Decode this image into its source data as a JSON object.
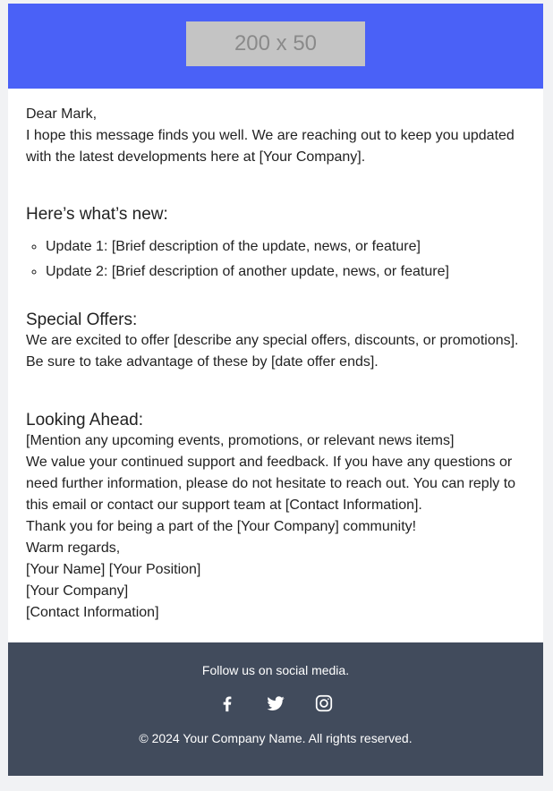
{
  "header": {
    "logo_placeholder": "200 x 50",
    "accent_color": "#4a61f7"
  },
  "body": {
    "greeting": "Dear Mark,",
    "intro": "I hope this message finds you well. We are reaching out to keep you updated with the latest developments here at [Your Company].",
    "whats_new": {
      "title": "Here’s what’s new:",
      "items": [
        "Update 1: [Brief description of the update, news, or feature]",
        "Update 2: [Brief description of another update, news, or feature]"
      ]
    },
    "special_offers": {
      "title": "Special Offers:",
      "text": "We are excited to offer [describe any special offers, discounts, or promotions]. Be sure to take advantage of these by [date offer ends]."
    },
    "looking_ahead": {
      "title": "Looking Ahead:",
      "text": "[Mention any upcoming events, promotions, or relevant news items]"
    },
    "support_text": "We value your continued support and feedback. If you have any questions or need further information, please do not hesitate to reach out. You can reply to this email or contact our support team at [Contact Information].",
    "thanks": "Thank you for being a part of the [Your Company] community!",
    "signoff": "Warm regards,",
    "signature": {
      "name_position": "[Your Name] [Your Position]",
      "company": "[Your Company]",
      "contact": "[Contact Information]"
    }
  },
  "footer": {
    "follow_text": "Follow us on social media.",
    "social_icons": [
      "facebook-icon",
      "twitter-icon",
      "instagram-icon"
    ],
    "copyright": "© 2024 Your Company Name. All rights reserved.",
    "background_color": "#414b5c"
  }
}
